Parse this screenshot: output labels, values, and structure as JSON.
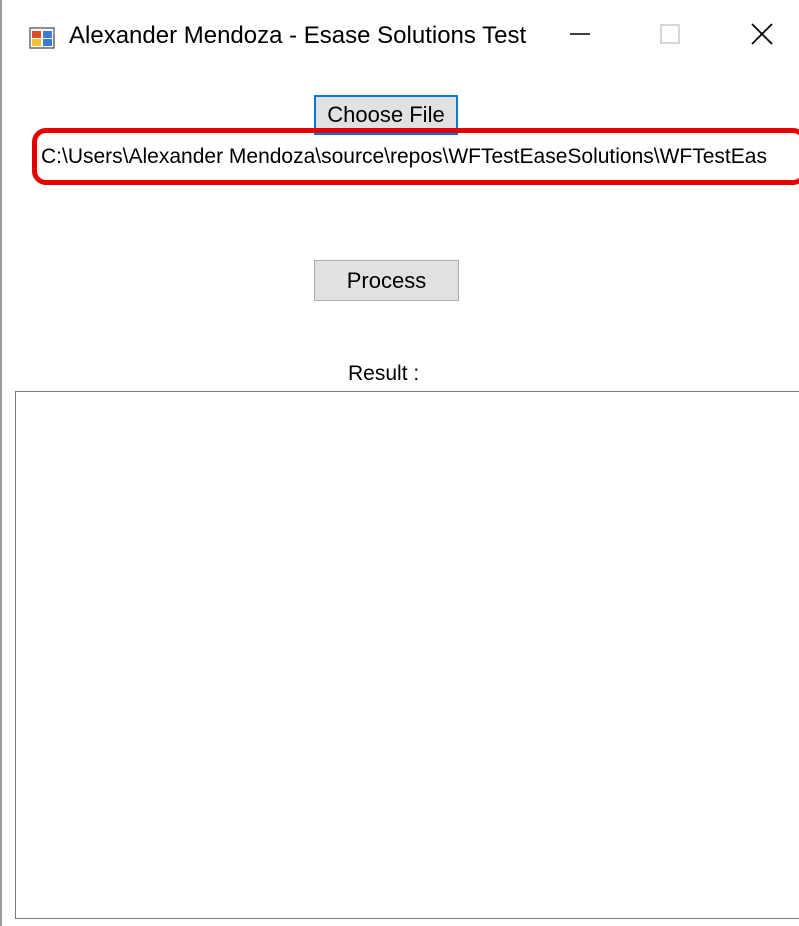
{
  "window": {
    "title": "Alexander Mendoza - Esase Solutions Test",
    "app_icon": "winforms-app-icon",
    "controls": {
      "minimize_icon": "minimize-icon",
      "maximize_icon": "maximize-icon",
      "close_icon": "close-icon"
    }
  },
  "form": {
    "choose_file_label": "Choose File",
    "file_path": "C:\\Users\\Alexander Mendoza\\source\\repos\\WFTestEaseSolutions\\WFTestEas",
    "process_label": "Process",
    "result_label": "Result :",
    "result_text": ""
  },
  "colors": {
    "highlight": "#e60000",
    "focus_border": "#0078d7",
    "button_bg": "#e1e1e1"
  }
}
